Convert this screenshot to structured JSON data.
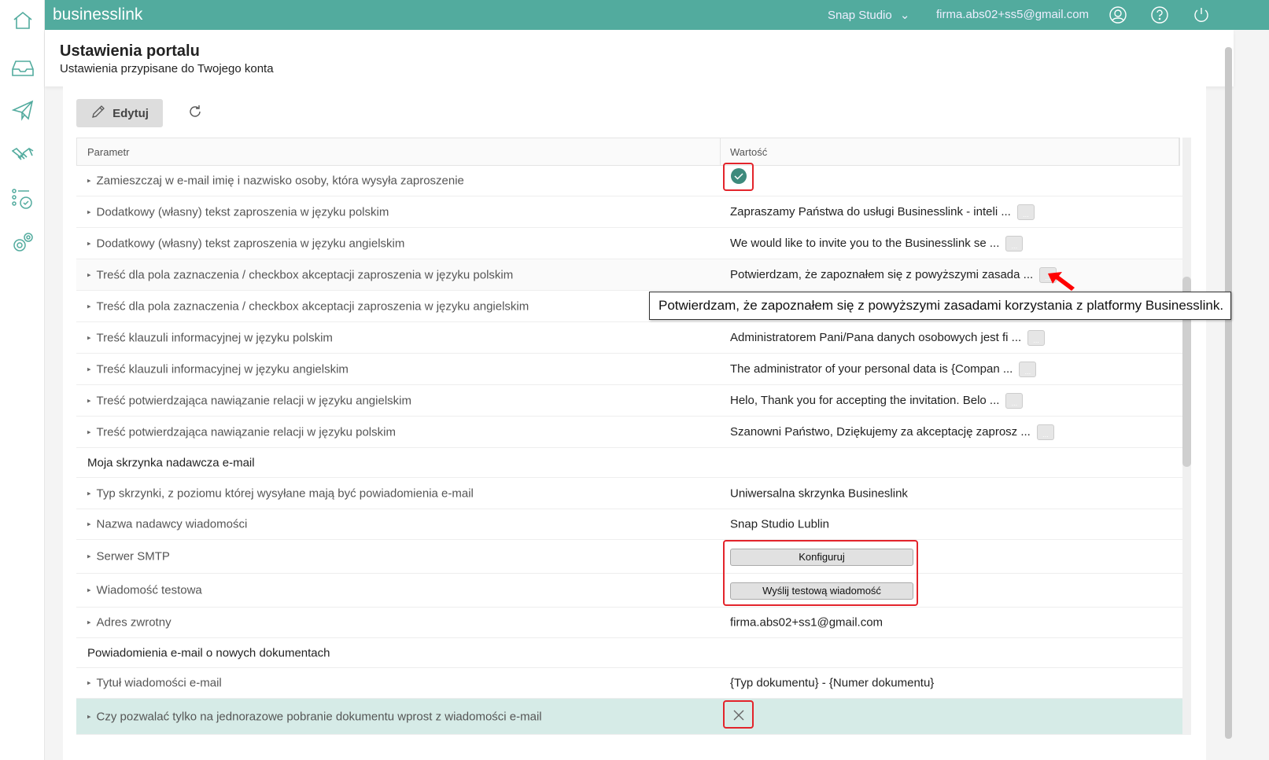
{
  "app": {
    "brand": "businesslink",
    "company": "Snap Studio",
    "user_email": "firma.abs02+ss5@gmail.com"
  },
  "sidebar": [
    "home-icon",
    "inbox-icon",
    "send-icon",
    "handshake-icon",
    "tasks-icon",
    "settings-icon"
  ],
  "page": {
    "title": "Ustawienia portalu",
    "subtitle": "Ustawienia przypisane do Twojego konta"
  },
  "toolbar": {
    "edit_label": "Edytuj"
  },
  "table": {
    "headers": {
      "param": "Parametr",
      "value": "Wartość"
    },
    "rows": [
      {
        "param": "Zamieszczaj w e-mail imię i nazwisko osoby, która wysyła zaproszenie",
        "value": "",
        "type": "check"
      },
      {
        "param": "Dodatkowy (własny) tekst zaproszenia w języku polskim",
        "value": "Zapraszamy Państwa do usługi Businesslink - inteli ...",
        "type": "text"
      },
      {
        "param": "Dodatkowy (własny) tekst zaproszenia w języku angielskim",
        "value": "We would like to invite you to the Businesslink se ...",
        "type": "text"
      },
      {
        "param": "Treść dla pola zaznaczenia / checkbox akceptacji zaproszenia w języku polskim",
        "value": "Potwierdzam, że zapoznałem się z powyższymi zasada ...",
        "type": "text"
      },
      {
        "param": "Treść dla pola zaznaczenia / checkbox akceptacji zaproszenia w języku angielskim",
        "value": "",
        "type": "plain"
      },
      {
        "param": "Treść klauzuli informacyjnej w języku polskim",
        "value": "Administratorem Pani/Pana danych osobowych jest fi ...",
        "type": "text"
      },
      {
        "param": "Treść klauzuli informacyjnej w języku angielskim",
        "value": "The administrator of your personal data is {Compan ...",
        "type": "text"
      },
      {
        "param": "Treść potwierdzająca nawiązanie relacji w języku angielskim",
        "value": "Helo, Thank you for accepting the invitation. Belo ...",
        "type": "text"
      },
      {
        "param": "Treść potwierdzająca nawiązanie relacji w języku polskim",
        "value": "Szanowni Państwo, Dziękujemy za akceptację zaprosz ...",
        "type": "text"
      },
      {
        "group": "Moja skrzynka nadawcza e-mail"
      },
      {
        "param": "Typ skrzynki, z poziomu której wysyłane mają być powiadomienia e-mail",
        "value": "Uniwersalna skrzynka Busineslink",
        "type": "plain"
      },
      {
        "param": "Nazwa nadawcy wiadomości",
        "value": "Snap Studio Lublin",
        "type": "plain"
      },
      {
        "param": "Serwer SMTP",
        "value": "Konfiguruj",
        "type": "button"
      },
      {
        "param": "Wiadomość testowa",
        "value": "Wyślij testową wiadomość",
        "type": "button"
      },
      {
        "param": "Adres zwrotny",
        "value": "firma.abs02+ss1@gmail.com",
        "type": "plain"
      },
      {
        "group": "Powiadomienia e-mail o nowych dokumentach"
      },
      {
        "param": "Tytuł wiadomości e-mail",
        "value": "{Typ dokumentu} - {Numer dokumentu}",
        "type": "plain"
      },
      {
        "param": "Czy pozwalać tylko na jednorazowe pobranie dokumentu wprost z wiadomości e-mail",
        "value": "",
        "type": "cross"
      }
    ]
  },
  "more_label": "...",
  "tooltip": "Potwierdzam, że zapoznałem się z powyższymi zasadami korzystania z platformy Businesslink.",
  "colors": {
    "brand": "#52ab9e",
    "check": "#3d8a7c",
    "highlight": "#d6ebe7",
    "annotation": "#e3242b"
  }
}
